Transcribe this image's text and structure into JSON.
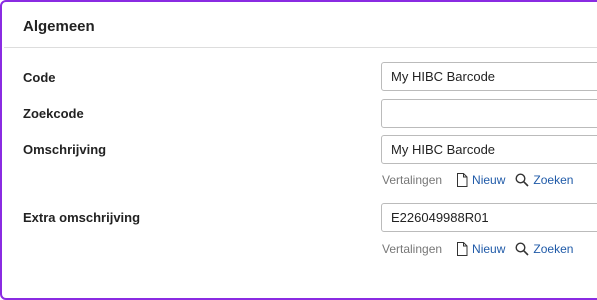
{
  "section": {
    "title": "Algemeen"
  },
  "fields": {
    "code": {
      "label": "Code",
      "value": "My HIBC Barcode"
    },
    "zoekcode": {
      "label": "Zoekcode",
      "value": ""
    },
    "omschrijving": {
      "label": "Omschrijving",
      "value": "My HIBC Barcode"
    },
    "extra_omschrijving": {
      "label": "Extra omschrijving",
      "value": "E226049988R01"
    }
  },
  "actions": {
    "translations_label": "Vertalingen",
    "new_label": "Nieuw",
    "search_label": "Zoeken"
  },
  "icons": {
    "new": "document-icon",
    "search": "search-icon"
  },
  "colors": {
    "accent_border": "#8a2be2",
    "link": "#1f5aa8",
    "muted_text": "#777777"
  }
}
